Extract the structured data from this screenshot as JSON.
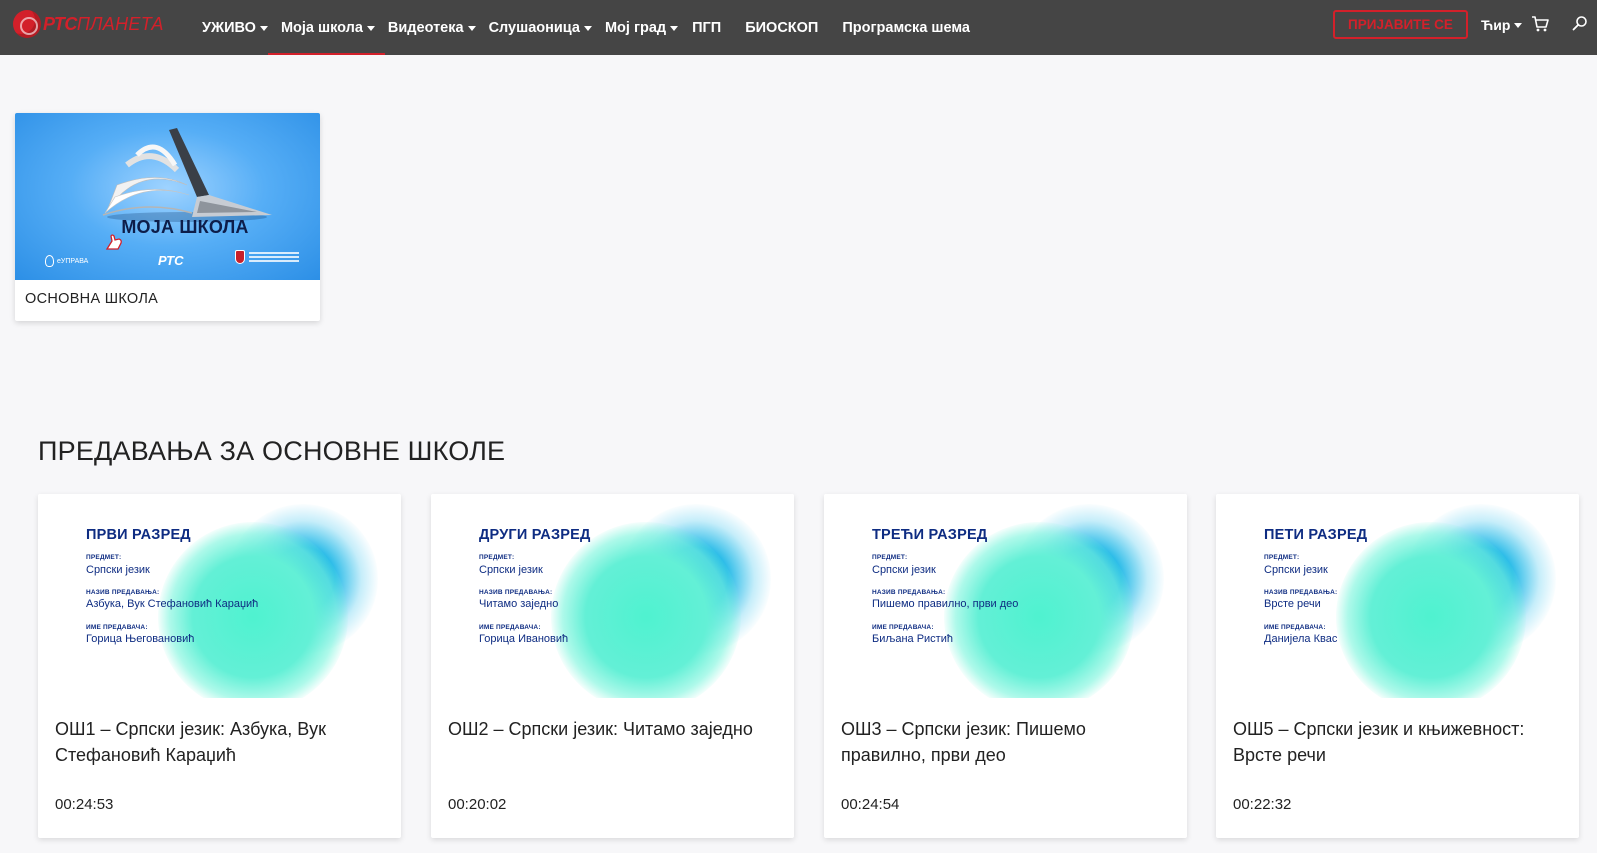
{
  "logo": {
    "rts": "РТС",
    "planeta": "ПЛАНЕТА"
  },
  "nav": [
    {
      "label": "УЖИВО",
      "dropdown": true
    },
    {
      "label": "Моја школа",
      "dropdown": true,
      "active": true
    },
    {
      "label": "Видеотека",
      "dropdown": true
    },
    {
      "label": "Слушаоница",
      "dropdown": true
    },
    {
      "label": "Мој град",
      "dropdown": true
    },
    {
      "label": "ПГП",
      "dropdown": false
    },
    {
      "label": "БИОСКОП",
      "dropdown": false
    },
    {
      "label": "Програмска шема",
      "dropdown": false
    }
  ],
  "header": {
    "login_label": "ПРИЈАВИТЕ СЕ",
    "lang_label": "Ћир",
    "cart_icon": "cart-icon",
    "search_icon": "search-icon"
  },
  "school_card": {
    "title": "МОЈА ШКОЛА",
    "eu_text": "eУПРАВА",
    "rts_text": "РТС",
    "label": "ОСНОВНА ШКОЛА"
  },
  "section": {
    "title": "ПРЕДАВАЊА ЗА ОСНОВНЕ ШКОЛЕ"
  },
  "lesson_meta_labels": {
    "subject": "ПРЕДМЕТ:",
    "lecture": "НАЗИВ ПРЕДАВАЊА:",
    "teacher": "ИМЕ ПРЕДАВАЧА:"
  },
  "cards": [
    {
      "grade": "ПРВИ РАЗРЕД",
      "subject": "Српски језик",
      "lecture": "Азбука, Вук Стефановић Караџић",
      "teacher": "Горица Његовановић",
      "title": "ОШ1 – Српски језик: Азбука, Вук Стефановић Караџић",
      "duration": "00:24:53"
    },
    {
      "grade": "ДРУГИ РАЗРЕД",
      "subject": "Српски језик",
      "lecture": "Читамо заједно",
      "teacher": "Горица Ивановић",
      "title": "ОШ2 – Српски језик: Читамо заједно",
      "duration": "00:20:02"
    },
    {
      "grade": "ТРЕЋИ РАЗРЕД",
      "subject": "Српски језик",
      "lecture": "Пишемо правилно, први део",
      "teacher": "Биљана Ристић",
      "title": "ОШ3 – Српски језик: Пишемо правилно, први део",
      "duration": "00:24:54"
    },
    {
      "grade": "ПЕТИ РАЗРЕД",
      "subject": "Српски језик",
      "lecture": "Врсте речи",
      "teacher": "Данијела Квас",
      "title": "ОШ5 – Српски језик и књижевност: Врсте речи",
      "duration": "00:22:32"
    }
  ],
  "colors": {
    "navbar": "#454545",
    "accent": "#d3202a",
    "lesson_text": "#0e2c82"
  }
}
